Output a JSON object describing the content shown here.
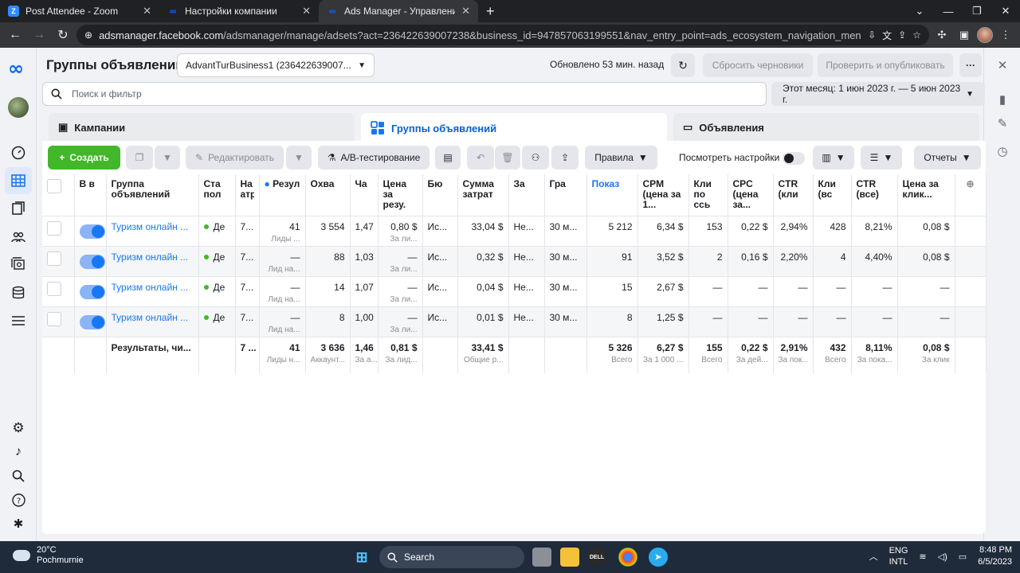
{
  "browser": {
    "tabs": [
      {
        "title": "Post Attendee - Zoom",
        "icon": "zoom-icon",
        "active": false
      },
      {
        "title": "Настройки компании",
        "icon": "meta-icon",
        "active": false
      },
      {
        "title": "Ads Manager - Управление рек",
        "icon": "meta-icon",
        "active": true
      }
    ],
    "url_host": "adsmanager.facebook.com",
    "url_rest": "/adsmanager/manage/adsets?act=236422639007238&business_id=947857063199551&nav_entry_point=ads_ecosystem_navigation_menu&column_pres..."
  },
  "header": {
    "title": "Группы объявлений",
    "account": "AdvantTurBusiness1 (236422639007...",
    "updated": "Обновлено 53 мин. назад",
    "discard_label": "Сбросить черновики",
    "publish_label": "Проверить и опубликовать",
    "more_label": "···"
  },
  "search": {
    "placeholder": "Поиск и фильтр"
  },
  "date_range": "Этот месяц: 1 июн 2023 г. — 5 июн 2023 г.",
  "level_tabs": {
    "campaigns": "Кампании",
    "adsets": "Группы объявлений",
    "ads": "Объявления"
  },
  "toolbar": {
    "create": "Создать",
    "edit": "Редактировать",
    "ab_test": "A/B-тестирование",
    "rules": "Правила",
    "view_settings": "Посмотреть настройки",
    "reports": "Отчеты"
  },
  "table": {
    "headers": [
      "В в",
      "Группа объявлений",
      "Ста пол",
      "На атр",
      "Резул",
      "Охва",
      "Ча",
      "Цена за резу.",
      "Бю",
      "Сумма затрат",
      "За",
      "Гра",
      "Показ",
      "CPM (цена за 1...",
      "Кли по ссь",
      "CPC (цена за...",
      "CTR (кли",
      "Кли (вс",
      "CTR (все)",
      "Цена за клик..."
    ],
    "rows": [
      {
        "name": "Туризм онлайн ...",
        "status": "Де",
        "attr": "7...",
        "results": "41",
        "results_sub": "Лиды ...",
        "reach": "3 554",
        "freq": "1,47",
        "cpr": "0,80 $",
        "cpr_sub": "За ли...",
        "budget": "Ис...",
        "spent": "33,04 $",
        "end": "Не...",
        "schedule": "30 м...",
        "impr": "5 212",
        "cpm": "6,34 $",
        "link_clicks": "153",
        "cpc": "0,22 $",
        "ctr_link": "2,94%",
        "clicks_all": "428",
        "ctr_all": "8,21%",
        "cost_per_click": "0,08 $"
      },
      {
        "name": "Туризм онлайн ...",
        "status": "Де",
        "attr": "7...",
        "results": "—",
        "results_sub": "Лид на...",
        "reach": "88",
        "freq": "1,03",
        "cpr": "—",
        "cpr_sub": "За ли...",
        "budget": "Ис...",
        "spent": "0,32 $",
        "end": "Не...",
        "schedule": "30 м...",
        "impr": "91",
        "cpm": "3,52 $",
        "link_clicks": "2",
        "cpc": "0,16 $",
        "ctr_link": "2,20%",
        "clicks_all": "4",
        "ctr_all": "4,40%",
        "cost_per_click": "0,08 $"
      },
      {
        "name": "Туризм онлайн ...",
        "status": "Де",
        "attr": "7...",
        "results": "—",
        "results_sub": "Лид на...",
        "reach": "14",
        "freq": "1,07",
        "cpr": "—",
        "cpr_sub": "За ли...",
        "budget": "Ис...",
        "spent": "0,04 $",
        "end": "Не...",
        "schedule": "30 м...",
        "impr": "15",
        "cpm": "2,67 $",
        "link_clicks": "—",
        "cpc": "—",
        "ctr_link": "—",
        "clicks_all": "—",
        "ctr_all": "—",
        "cost_per_click": "—"
      },
      {
        "name": "Туризм онлайн ...",
        "status": "Де",
        "attr": "7...",
        "results": "—",
        "results_sub": "Лид на...",
        "reach": "8",
        "freq": "1,00",
        "cpr": "—",
        "cpr_sub": "За ли...",
        "budget": "Ис...",
        "spent": "0,01 $",
        "end": "Не...",
        "schedule": "30 м...",
        "impr": "8",
        "cpm": "1,25 $",
        "link_clicks": "—",
        "cpc": "—",
        "ctr_link": "—",
        "clicks_all": "—",
        "ctr_all": "—",
        "cost_per_click": "—"
      }
    ],
    "totals": {
      "label": "Результаты, чи...",
      "attr": "7 ...",
      "results": "41",
      "results_sub": "Лиды н...",
      "reach": "3 636",
      "reach_sub": "Аккаунт...",
      "freq": "1,46",
      "freq_sub": "За а...",
      "cpr": "0,81 $",
      "cpr_sub": "За лид...",
      "spent": "33,41 $",
      "spent_sub": "Общие р...",
      "impr": "5 326",
      "impr_sub": "Всего",
      "cpm": "6,27 $",
      "cpm_sub": "За 1 000 ...",
      "link_clicks": "155",
      "link_clicks_sub": "Всего",
      "cpc": "0,22 $",
      "cpc_sub": "За дей...",
      "ctr_link": "2,91%",
      "ctr_link_sub": "За пок...",
      "clicks_all": "432",
      "clicks_all_sub": "Всего",
      "ctr_all": "8,11%",
      "ctr_all_sub": "За пока...",
      "cost_per_click": "0,08 $",
      "cost_per_click_sub": "За клик"
    }
  },
  "taskbar": {
    "temp": "20°C",
    "place": "Pochmurnie",
    "search": "Search",
    "lang1": "ENG",
    "lang2": "INTL",
    "time": "8:48 PM",
    "date": "6/5/2023"
  },
  "colors": {
    "accent": "#1877f2",
    "create": "#42b72a",
    "meta": "#0866ff"
  }
}
